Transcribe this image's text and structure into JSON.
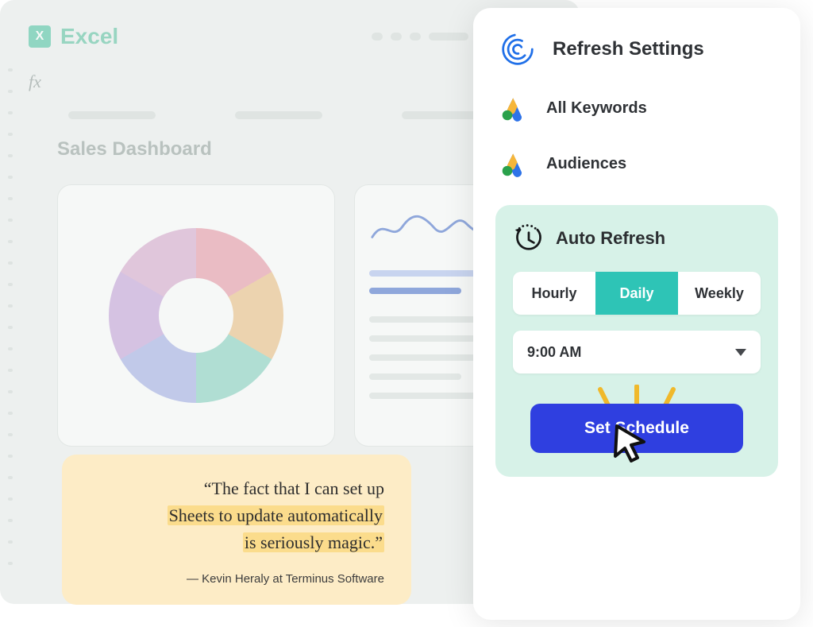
{
  "background": {
    "app_name": "Excel",
    "fx_label": "fx",
    "dashboard_title": "Sales Dashboard"
  },
  "quote": {
    "line1": "“The fact that I can set up",
    "line2_hl": "Sheets to update automatically",
    "line3_pre": "",
    "line3_hl": "is seriously magic.”",
    "attribution": "— Kevin Heraly at Terminus Software"
  },
  "panel": {
    "title": "Refresh Settings",
    "items": [
      {
        "label": "All Keywords"
      },
      {
        "label": "Audiences"
      }
    ],
    "auto_refresh": {
      "title": "Auto Refresh",
      "segments": {
        "hourly": "Hourly",
        "daily": "Daily",
        "weekly": "Weekly",
        "active": "daily"
      },
      "time_value": "9:00 AM",
      "cta_label": "Set Schedule"
    }
  },
  "colors": {
    "accent_teal": "#2ec4b6",
    "cta_blue": "#2f3fe0",
    "panel_mint": "#d7f2e8",
    "quote_bg": "#fdecc6",
    "highlight": "#fbdc8c"
  }
}
